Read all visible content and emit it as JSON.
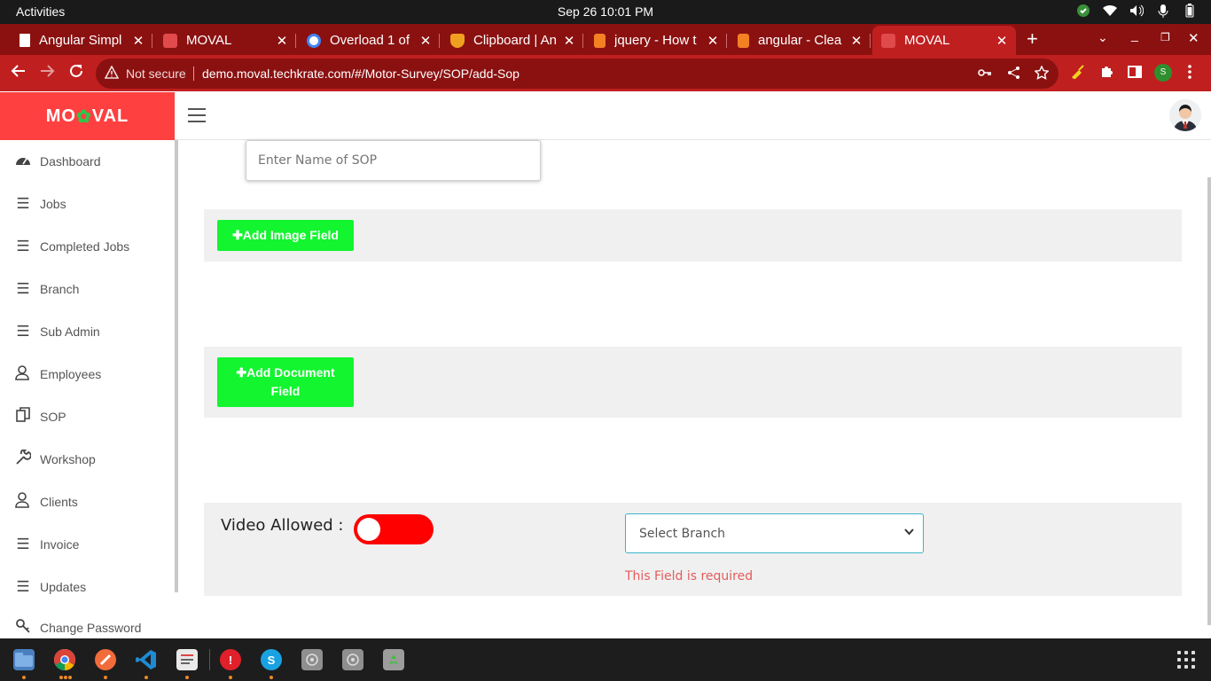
{
  "system": {
    "activities": "Activities",
    "clock": "Sep 26  10:01 PM"
  },
  "browser": {
    "tabs": [
      {
        "title": "Angular Simpl",
        "favicon_color": "#ffffff"
      },
      {
        "title": "MOVAL",
        "favicon_color": "#e04a4a"
      },
      {
        "title": "Overload 1 of",
        "favicon_color": "#4285f4"
      },
      {
        "title": "Clipboard | An",
        "favicon_color": "#f0a020"
      },
      {
        "title": "jquery - How t",
        "favicon_color": "#f48024"
      },
      {
        "title": "angular - Clea",
        "favicon_color": "#f48024"
      },
      {
        "title": "MOVAL",
        "favicon_color": "#e04a4a"
      }
    ],
    "not_secure": "Not secure",
    "url": "demo.moval.techkrate.com/#/Motor-Survey/SOP/add-Sop",
    "profile_initial": "S",
    "theme_color": "#c01f20"
  },
  "app": {
    "brand_left": "MO",
    "brand_mid": "✿",
    "brand_right": "VAL",
    "brand_color": "#ff4040",
    "sidebar": [
      {
        "label": "Dashboard",
        "icon": "gauge-icon"
      },
      {
        "label": "Jobs",
        "icon": "list-icon"
      },
      {
        "label": "Completed Jobs",
        "icon": "list-icon"
      },
      {
        "label": "Branch",
        "icon": "list-icon"
      },
      {
        "label": "Sub Admin",
        "icon": "list-icon"
      },
      {
        "label": "Employees",
        "icon": "users-icon"
      },
      {
        "label": "SOP",
        "icon": "copy-icon"
      },
      {
        "label": "Workshop",
        "icon": "wrench-icon"
      },
      {
        "label": "Clients",
        "icon": "user-icon"
      },
      {
        "label": "Invoice",
        "icon": "list-icon"
      },
      {
        "label": "Updates",
        "icon": "list-icon"
      },
      {
        "label": "Change Password",
        "icon": "key-icon"
      }
    ],
    "form": {
      "sop_name_placeholder": "Enter Name of SOP",
      "add_image_label": "Add Image Field",
      "add_document_label": "Add Document Field",
      "video_label": "Video Allowed :",
      "video_allowed": false,
      "branch_select": "Select Branch",
      "branch_error": "This Field is required",
      "button_color": "#12f52f",
      "toggle_color": "#ff0000"
    }
  }
}
